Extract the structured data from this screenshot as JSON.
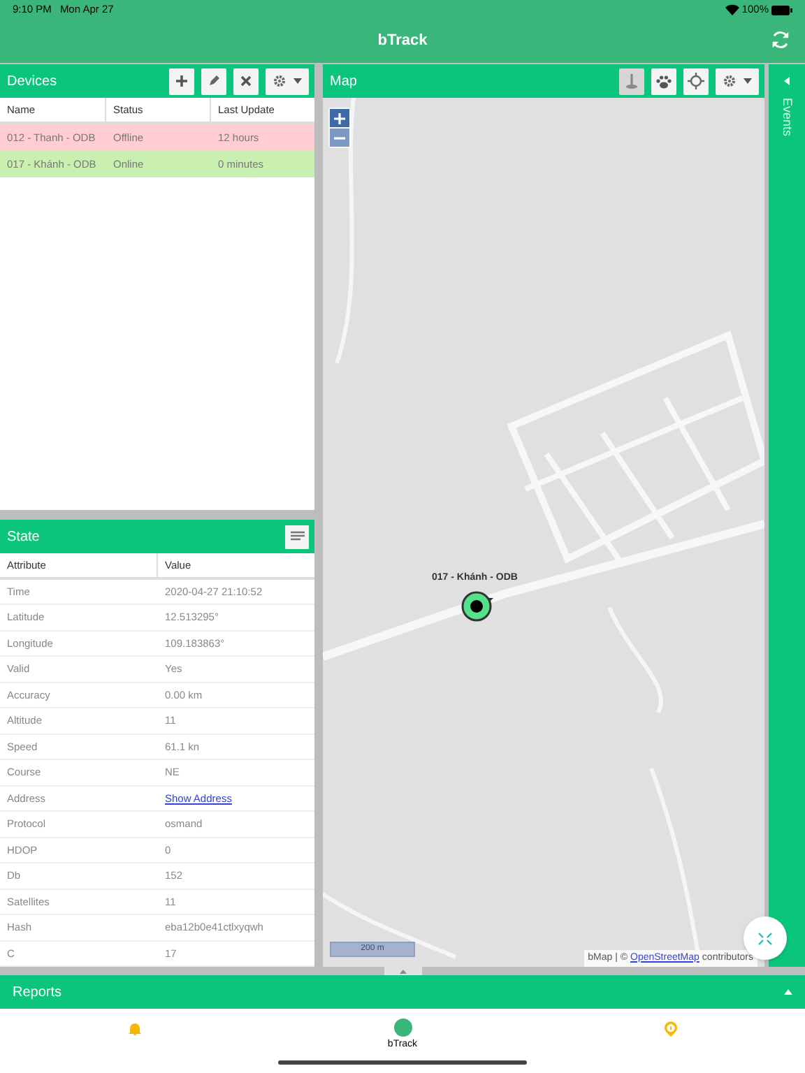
{
  "status_bar": {
    "time": "9:10 PM",
    "date": "Mon Apr 27",
    "battery": "100%"
  },
  "app_bar": {
    "title": "bTrack"
  },
  "devices": {
    "title": "Devices",
    "tools": [
      {
        "kind": "add"
      },
      {
        "kind": "edit"
      },
      {
        "kind": "remove"
      },
      {
        "kind": "settings"
      }
    ],
    "columns": [
      "Name",
      "Status",
      "Last Update"
    ],
    "rows": [
      {
        "name": "012 - Thanh - ODB",
        "status": "Offline",
        "last_update": "12 hours",
        "color": "#ffcdd2"
      },
      {
        "name": "017 - Khánh - ODB",
        "status": "Online",
        "last_update": "0 minutes",
        "color": "#c9f0b1"
      }
    ]
  },
  "map": {
    "title": "Map",
    "tools": [
      {
        "kind": "pin",
        "selected": true
      },
      {
        "kind": "paw",
        "selected": false
      },
      {
        "kind": "target",
        "selected": false
      },
      {
        "kind": "settings",
        "selected": false
      }
    ],
    "marker_label": "017 - Khánh - ODB",
    "scale": "200 m",
    "attribution_prefix": "bMap | ©",
    "attribution_link": "OpenStreetMap",
    "attribution_suffix": "contributors"
  },
  "events": {
    "title": "Events"
  },
  "state": {
    "title": "State",
    "columns": [
      "Attribute",
      "Value"
    ],
    "rows": [
      {
        "attribute": "Time",
        "value": "2020-04-27 21:10:52",
        "kind": "text"
      },
      {
        "attribute": "Latitude",
        "value": "12.513295°",
        "kind": "text"
      },
      {
        "attribute": "Longitude",
        "value": "109.183863°",
        "kind": "text"
      },
      {
        "attribute": "Valid",
        "value": "Yes",
        "kind": "text"
      },
      {
        "attribute": "Accuracy",
        "value": "0.00 km",
        "kind": "text"
      },
      {
        "attribute": "Altitude",
        "value": "11",
        "kind": "text"
      },
      {
        "attribute": "Speed",
        "value": "61.1 kn",
        "kind": "text"
      },
      {
        "attribute": "Course",
        "value": "NE",
        "kind": "text"
      },
      {
        "attribute": "Address",
        "value": "Show Address",
        "kind": "link"
      },
      {
        "attribute": "Protocol",
        "value": "osmand",
        "kind": "text"
      },
      {
        "attribute": "HDOP",
        "value": "0",
        "kind": "text"
      },
      {
        "attribute": "Db",
        "value": "152",
        "kind": "text"
      },
      {
        "attribute": "Satellites",
        "value": "11",
        "kind": "text"
      },
      {
        "attribute": "Hash",
        "value": "eba12b0e41ctlxyqwh",
        "kind": "text"
      },
      {
        "attribute": "C",
        "value": "17",
        "kind": "text"
      }
    ]
  },
  "reports": {
    "title": "Reports"
  },
  "tab_bar": [
    {
      "kind": "bell"
    },
    {
      "kind": "logo",
      "label": "bTrack"
    },
    {
      "kind": "info"
    }
  ]
}
